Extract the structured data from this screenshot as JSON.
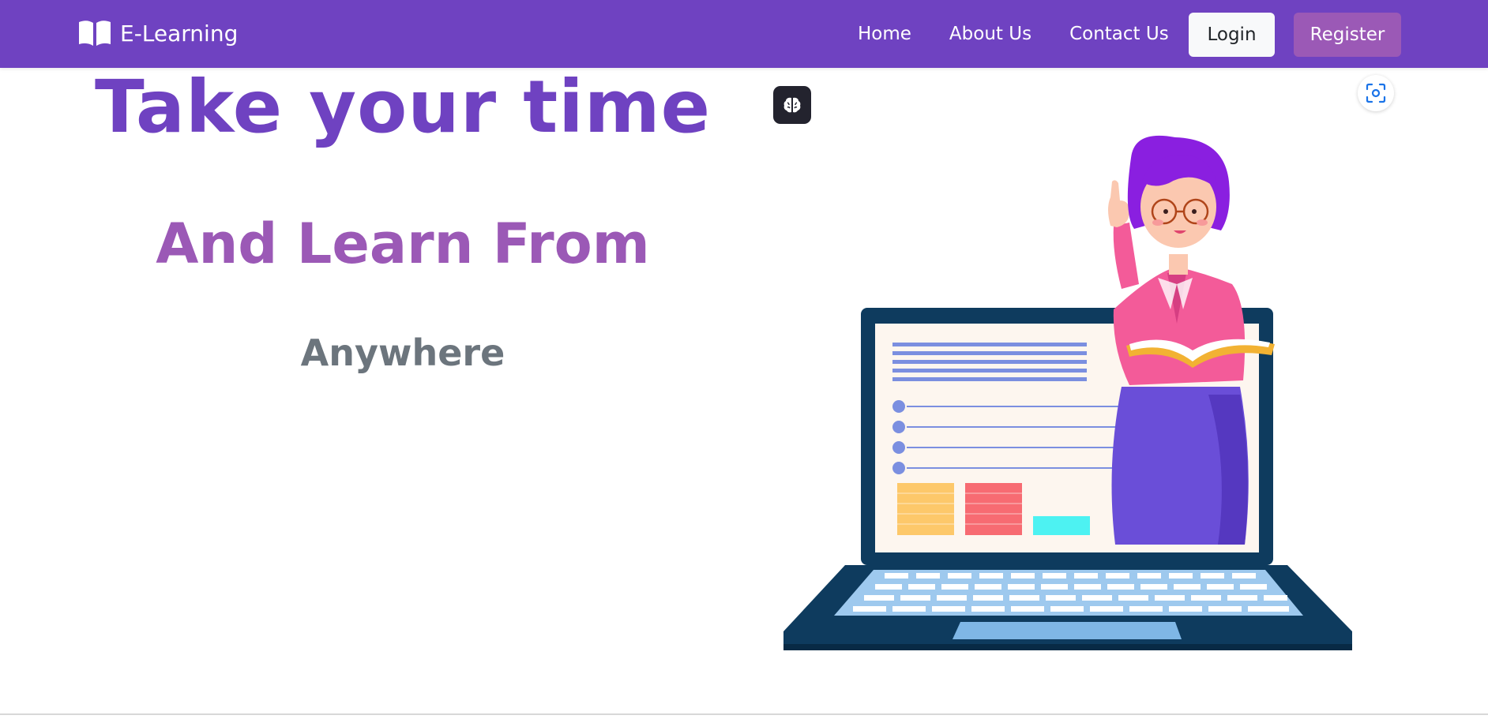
{
  "navbar": {
    "brand_label": "E-Learning",
    "brand_icon": "open-book-icon",
    "links": [
      "Home",
      "About Us",
      "Contact Us"
    ],
    "login_label": "Login",
    "register_label": "Register"
  },
  "hero": {
    "title": "Take your time",
    "subtitle": "And Learn From",
    "tagline": "Anywhere"
  },
  "floating": {
    "brain_icon": "brain-icon",
    "scan_icon": "screen-scan-icon"
  },
  "colors": {
    "primary": "#6f42c1",
    "accent": "#9b59b6",
    "muted": "#6c757d"
  }
}
